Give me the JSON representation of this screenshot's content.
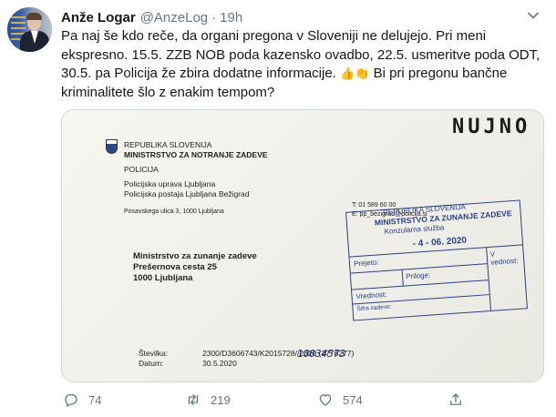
{
  "author": {
    "name": "Anže Logar",
    "handle": "@AnzeLog",
    "time": "19h"
  },
  "tweet_text": "Pa naj še kdo reče, da organi pregona v Sloveniji ne delujejo. Pri meni ekspresno. 15.5. ZZB NOB poda kazensko ovadbo, 22.5. usmeritve poda ODT, 30.5. pa Policija že zbira dodatne informacije.",
  "emojis": "👍👏",
  "tweet_text_2": "Bi pri pregonu bančne kriminalitete šlo z enakim tempom?",
  "document": {
    "nujno": "NUJNO",
    "hdr1": "REPUBLIKA SLOVENIJA",
    "hdr2": "MINISTRSTVO ZA NOTRANJE ZADEVE",
    "hdr3": "POLICIJA",
    "hdr4": "Policijska uprava Ljubljana",
    "hdr5": "Policijska postaja Ljubljana Bežigrad",
    "hdr6": "Posavskega ulica 3, 1000 Ljubljana",
    "rcp1": "Ministrstvo za zunanje zadeve",
    "rcp2": "Prešernova cesta 25",
    "rcp3": "1000 Ljubljana",
    "contact1": "T: 01 589 60 00",
    "contact2": "E: pp_bezigrad@policija.si",
    "stevilka_label": "Številka:",
    "stevilka_value": "2300/D3606743/K2015728/",
    "stevilka_hand": "10034573",
    "stevilka_tail": "/2020   (2776277)",
    "datum_label": "Datum:",
    "datum_value": "30.5.2020",
    "stamp_l1": "REPUBLIKA SLOVENIJA",
    "stamp_l2": "MINISTRSTVO ZA ZUNANJE ZADEVE",
    "stamp_l3": "Konzularna služba",
    "stamp_date": "- 4 - 06. 2020",
    "stamp_prejeto": "Prejeto:",
    "stamp_prilog": "Priloge:",
    "stamp_vrednost": "Vrednost:",
    "stamp_sifra": "Šifra zadeve:",
    "stamp_vvednost": "V vednost:"
  },
  "actions": {
    "reply_count": "74",
    "retweet_count": "219",
    "like_count": "574"
  }
}
